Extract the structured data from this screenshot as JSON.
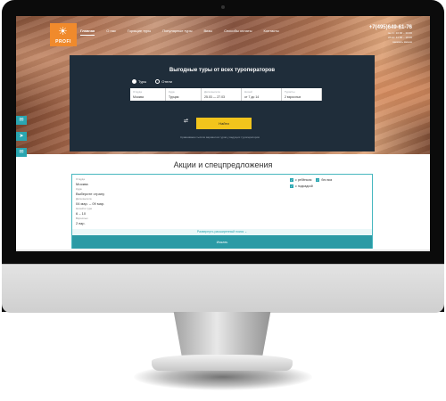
{
  "logo": {
    "text": "PROFI"
  },
  "nav": {
    "items": [
      {
        "label": "Главная",
        "active": true
      },
      {
        "label": "О нас",
        "active": false
      },
      {
        "label": "Горящие туры",
        "active": false
      },
      {
        "label": "Популярные туры",
        "active": false
      },
      {
        "label": "Визы",
        "active": false
      },
      {
        "label": "Способы оплаты",
        "active": false
      },
      {
        "label": "Контакты",
        "active": false
      }
    ]
  },
  "contact": {
    "phone": "+7(495)649-61-76",
    "lines": [
      "пн-пт: 10:00 – 20:00",
      "сб-вс: 11:00 – 18:00",
      "заказать звонок"
    ]
  },
  "search": {
    "title": "Выгодные туры от всех туроператоров",
    "radios": [
      {
        "label": "Туры",
        "selected": true
      },
      {
        "label": "Отели",
        "selected": false
      }
    ],
    "fields": [
      {
        "label": "Откуда",
        "value": "Москва"
      },
      {
        "label": "Куда",
        "value": "Турция"
      },
      {
        "label": "Дата вылета",
        "value": "25.03 — 27.03"
      },
      {
        "label": "Ночей",
        "value": "от 7 до 14"
      },
      {
        "label": "Туристы",
        "value": "2 взрослых"
      }
    ],
    "button_label": "Найти",
    "hint": "Сравниваем тысячи вариантов туров у ведущих туроператоров"
  },
  "section": {
    "title": "Акции и спецпредложения"
  },
  "filters": {
    "groups": [
      {
        "label": "Откуда",
        "value": "Москва"
      },
      {
        "label": "Куда",
        "value": "Выберите страну"
      },
      {
        "label": "Дата вылета",
        "value": "04 мар. – 09 мар."
      },
      {
        "label": "Ночей в туре",
        "value": "6 – 10"
      },
      {
        "label": "Взрослых",
        "value": "2 взр."
      }
    ],
    "checks": [
      "с ребёнком",
      "без виз",
      "с подсадкой"
    ],
    "expand_label": "Развернуть расширенный поиск",
    "show_label": "Искать"
  },
  "colors": {
    "accent": "#2aa6b1",
    "button": "#f2c41c",
    "panel": "#1f2d3a"
  }
}
